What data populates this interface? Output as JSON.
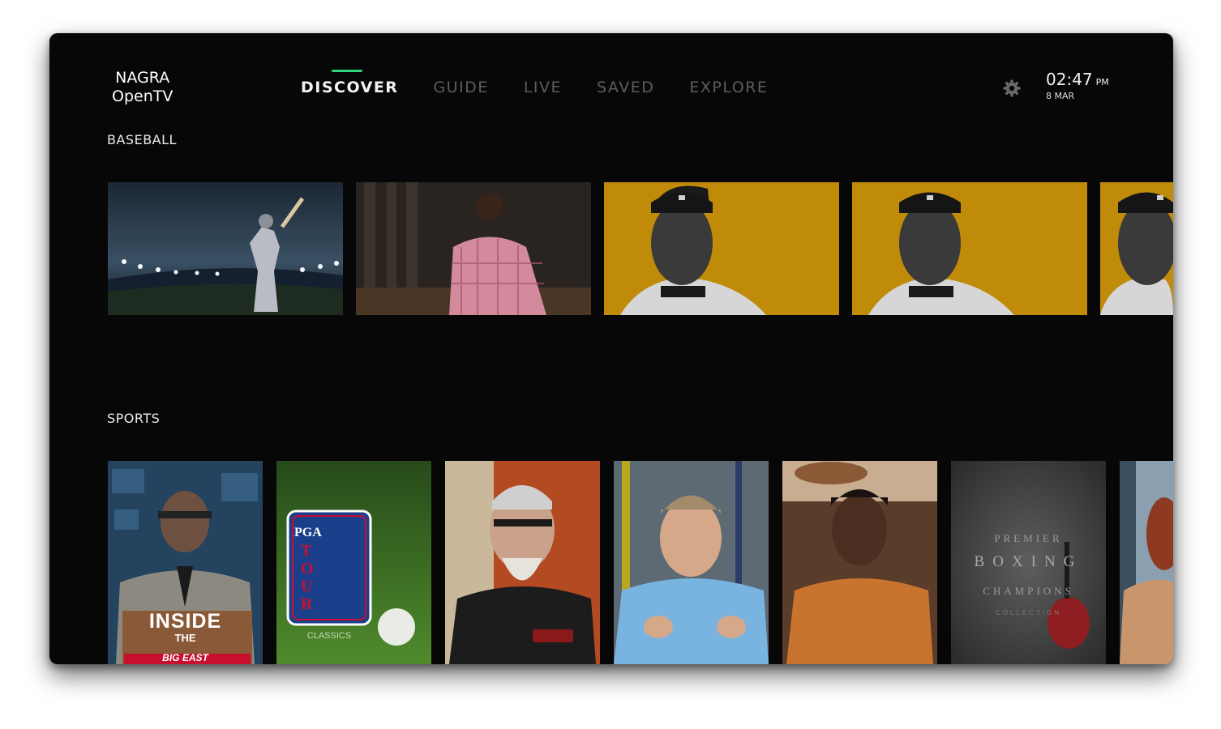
{
  "app": {
    "logo_line1": "NAGRA",
    "logo_line2": "OpenTV",
    "accent_color": "#2fd67e"
  },
  "nav": {
    "items": [
      {
        "label": "DISCOVER",
        "active": true
      },
      {
        "label": "GUIDE",
        "active": false
      },
      {
        "label": "LIVE",
        "active": false
      },
      {
        "label": "SAVED",
        "active": false
      },
      {
        "label": "EXPLORE",
        "active": false
      }
    ]
  },
  "header": {
    "settings_icon": "gear-icon",
    "time": "02:47",
    "ampm": "PM",
    "date": "8 MAR"
  },
  "sections": [
    {
      "title": "BASEBALL",
      "tiles": [
        {
          "name": "baseball-stadium-batter"
        },
        {
          "name": "woman-plaid-shirt"
        },
        {
          "name": "baseball-player-portrait"
        },
        {
          "name": "baseball-player-portrait"
        },
        {
          "name": "baseball-player-portrait"
        }
      ]
    },
    {
      "title": "SPORTS",
      "tiles": [
        {
          "name": "inside-the-big-east",
          "text1": "INSIDE",
          "text2": "THE",
          "text3": "BIG EAST"
        },
        {
          "name": "pga-tour-classics",
          "text1": "PGA",
          "text2": "TOUR",
          "text3": "CLASSICS"
        },
        {
          "name": "bearded-man-glasses"
        },
        {
          "name": "man-blue-shirt"
        },
        {
          "name": "woman-orange-shirt"
        },
        {
          "name": "premier-boxing-champions",
          "text1": "PREMIER",
          "text2": "BOXING",
          "text3": "CHAMPIONS",
          "text4": "COLLECTION"
        },
        {
          "name": "partial-tile"
        }
      ]
    }
  ]
}
